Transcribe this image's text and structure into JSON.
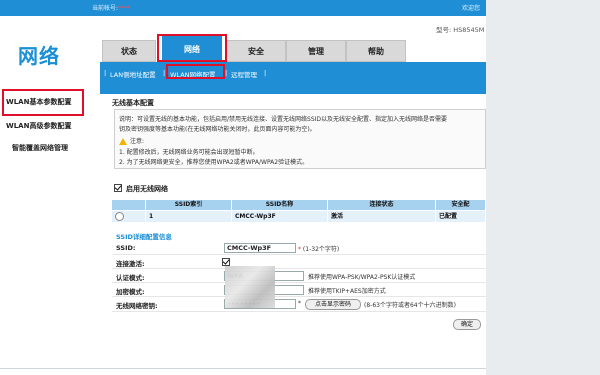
{
  "topbar": {
    "user_label": "当前帐号:",
    "user_value": "****",
    "welcome": "欢迎您 "
  },
  "model": "型号: HS8545M",
  "logo": "网络",
  "tabs": [
    {
      "label": "状态"
    },
    {
      "label": "网络"
    },
    {
      "label": "安全"
    },
    {
      "label": "管理"
    },
    {
      "label": "帮助"
    }
  ],
  "subnav": {
    "items": [
      "LAN侧地址配置",
      "WLAN网络配置",
      "远程管理"
    ],
    "separator": "|"
  },
  "left_nav": {
    "items": [
      "WLAN基本参数配置",
      "WLAN高级参数配置",
      "智能覆盖网络管理"
    ]
  },
  "section": {
    "title": "无线基本配置",
    "desc_line1": "说明：可设置无线的基本功能，包括启用/禁用无线连接、设置无线网络SSID以及无线安全配置、指定加入无线网络是否需要",
    "desc_line2": "钥及密钥强度等基本功能(在无线网络功能关闭时，此页面内容可能为空)。",
    "note_label": "注意:",
    "note1": "1. 配置修改后，无线网络业务可能会出现短暂中断。",
    "note2": "2. 为了无线网络更安全，推荐您使用WPA2或者WPA/WPA2验证模式。"
  },
  "enable_wlan": {
    "label": "启用无线网络",
    "checked": true
  },
  "ssid_table": {
    "headers": [
      "SSID索引",
      "SSID名称",
      "连接状态",
      "安全配"
    ],
    "rows": [
      {
        "index": "1",
        "name": "CMCC-Wp3F",
        "status": "激活",
        "security": "已配置"
      }
    ]
  },
  "detail": {
    "title": "SSID详细配置信息",
    "ssid_label": "SSID:",
    "ssid_value": "CMCC-Wp3F",
    "ssid_hint": "(1-32个字符)",
    "required_mark": "*",
    "connect_label": "连接激活:",
    "connect_checked": true,
    "auth_label": "认证模式:",
    "auth_value": "WPA",
    "auth_hint": "推荐使用WPA-PSK/WPA2-PSK认证模式",
    "enc_label": "加密模式:",
    "enc_hint": "推荐使用TKIP+AES加密方式",
    "key_label": "无线网络密钥:",
    "key_value": "••••••••",
    "show_pwd_button": "点击显示密码",
    "key_hint": "(8-63个字符或者64个十六进制数)",
    "ok_button": "确定"
  },
  "colors": {
    "brand_blue": "#1f8ed4",
    "highlight_red": "#e0102a",
    "table_header": "#a7d2ef"
  }
}
